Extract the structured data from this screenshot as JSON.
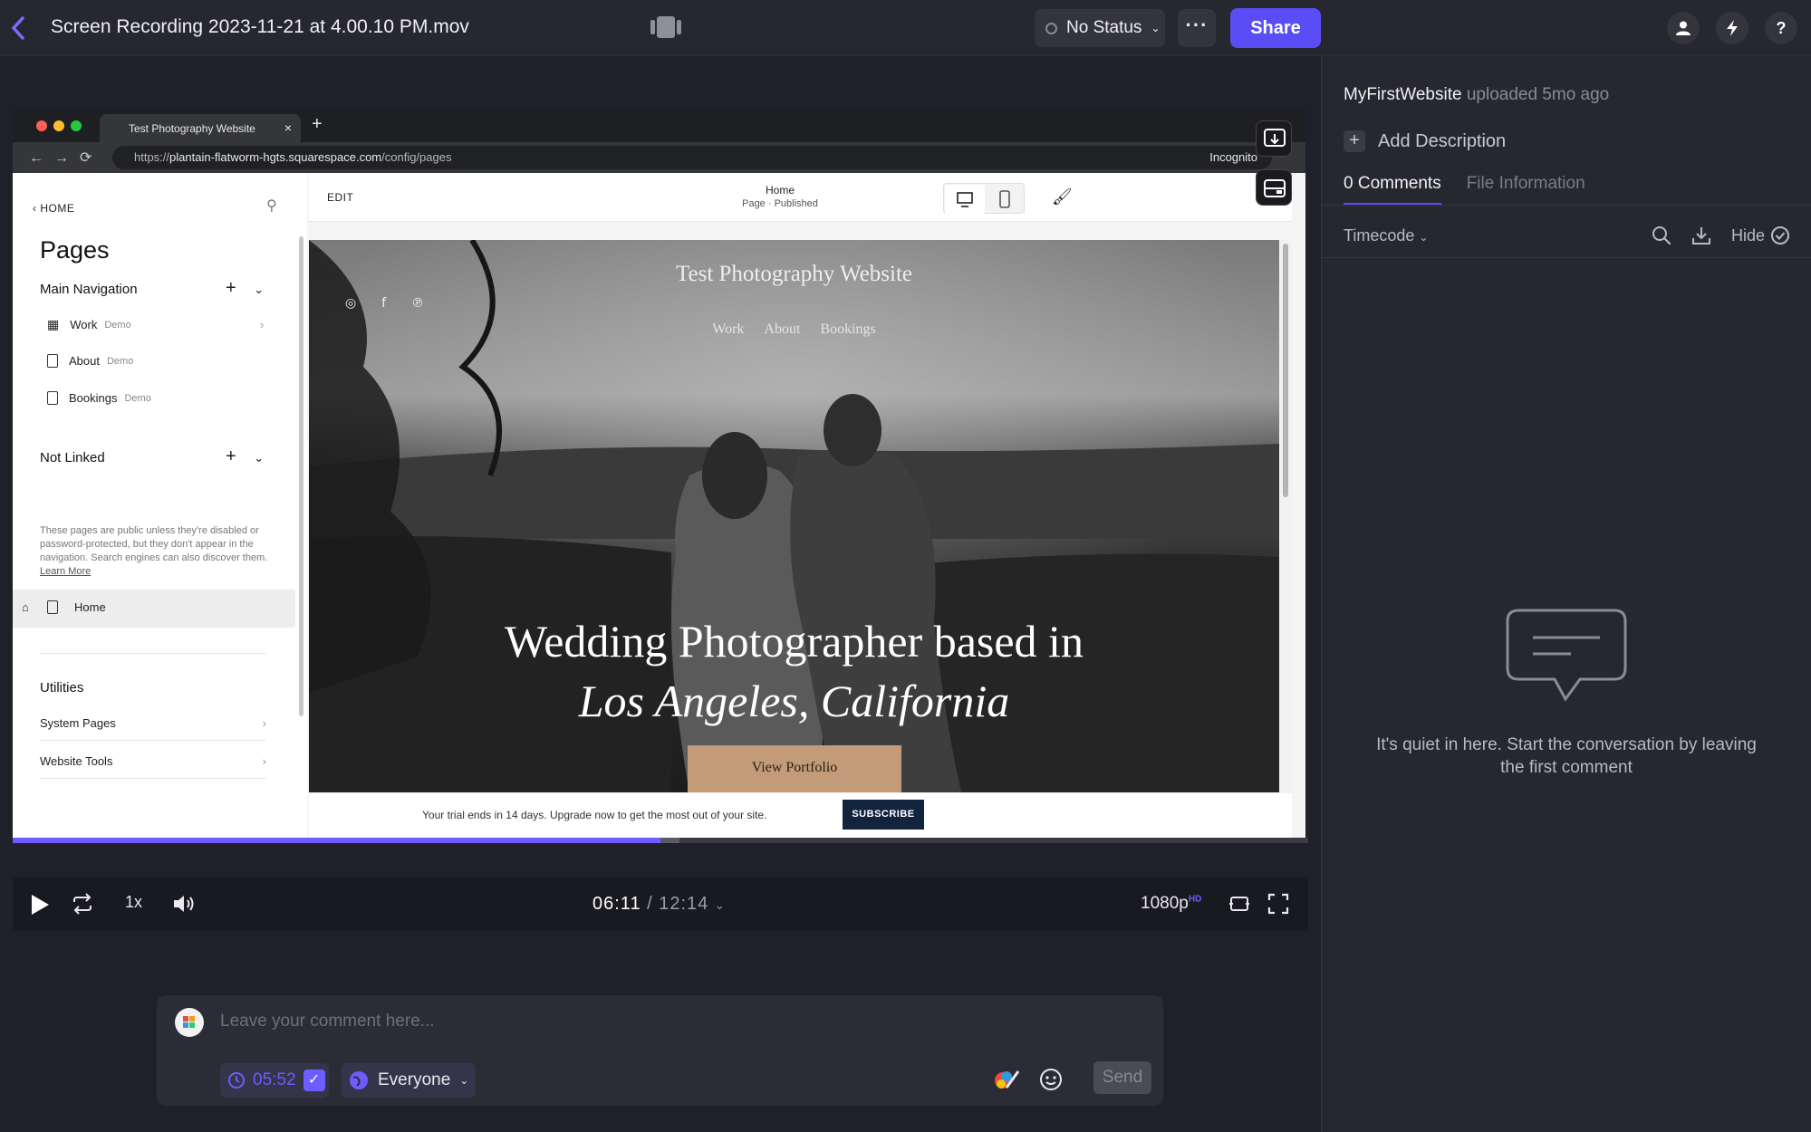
{
  "header": {
    "file_title": "Screen Recording 2023-11-21 at 4.00.10 PM.mov",
    "status_label": "No Status",
    "share_label": "Share"
  },
  "panel": {
    "uploader_name": "MyFirstWebsite",
    "uploaded_text": "uploaded 5mo ago",
    "add_description": "Add Description",
    "tabs": [
      "0 Comments",
      "File Information"
    ],
    "sort_label": "Timecode",
    "hide_label": "Hide",
    "empty_text": "It's quiet in here. Start the conversation by leaving the first comment"
  },
  "browser": {
    "tab_title": "Test Photography Website",
    "url_prefix": "https://",
    "url_host": "plantain-flatworm-hgts.squarespace.com",
    "url_path": "/config/pages",
    "incognito_label": "Incognito"
  },
  "editor": {
    "home_link": "HOME",
    "pages_title": "Pages",
    "main_nav_label": "Main Navigation",
    "main_nav_items": [
      {
        "label": "Work",
        "badge": "Demo"
      },
      {
        "label": "About",
        "badge": "Demo"
      },
      {
        "label": "Bookings",
        "badge": "Demo"
      }
    ],
    "not_linked_label": "Not Linked",
    "not_linked_note": "These pages are public unless they're disabled or password-protected, but they don't appear in the navigation. Search engines can also discover them.",
    "learn_more": "Learn More",
    "home_page": "Home",
    "utilities_label": "Utilities",
    "system_pages": "System Pages",
    "website_tools": "Website Tools",
    "edit_label": "EDIT",
    "page_name": "Home",
    "page_status": "Page · Published"
  },
  "site": {
    "title": "Test Photography Website",
    "nav": [
      "Work",
      "About",
      "Bookings"
    ],
    "headline_line1": "Wedding Photographer based in",
    "headline_line2": "Los Angeles, California",
    "cta_label": "View Portfolio",
    "trial_text": "Your trial ends in 14 days. Upgrade now to get the most out of your site.",
    "subscribe_label": "SUBSCRIBE"
  },
  "player": {
    "speed": "1x",
    "current_time": "06:11",
    "total_time": "/ 12:14",
    "quality": "1080p",
    "quality_badge": "HD",
    "progress": 0.5,
    "buffered": 0.515
  },
  "comment": {
    "placeholder": "Leave your comment here...",
    "timestamp": "05:52",
    "audience": "Everyone",
    "send_label": "Send"
  },
  "colors": {
    "accent": "#5b4df5",
    "app_bg": "#1f2029",
    "panel_bg": "#26272f"
  }
}
